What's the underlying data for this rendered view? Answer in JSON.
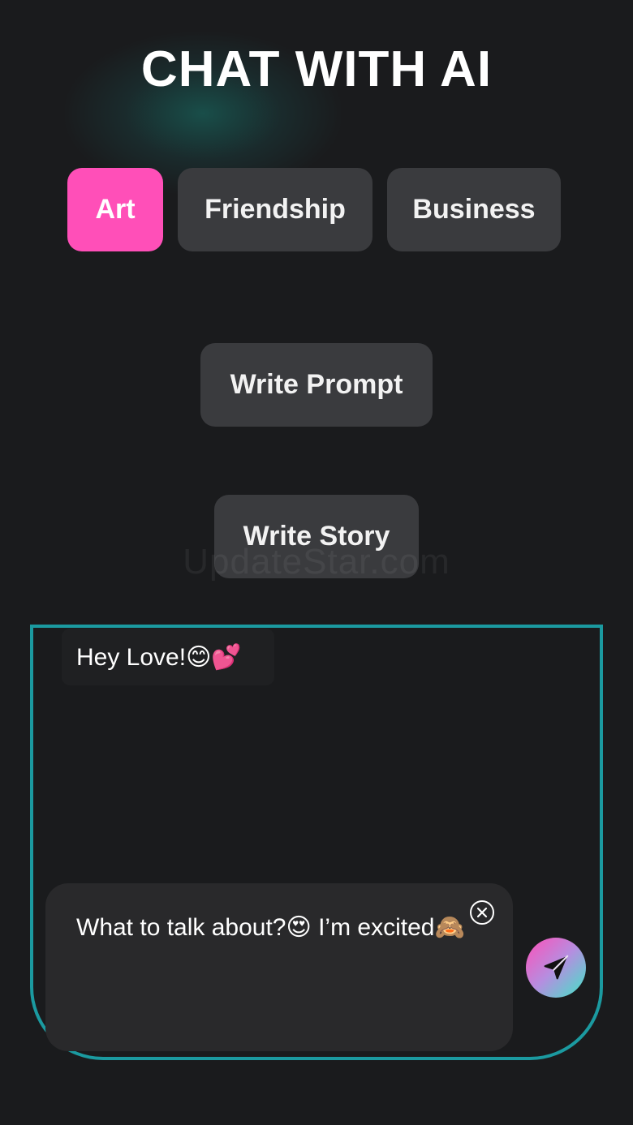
{
  "header": {
    "title": "CHAT WITH AI"
  },
  "categories": [
    {
      "label": "Art",
      "active": true
    },
    {
      "label": "Friendship",
      "active": false
    },
    {
      "label": "Business",
      "active": false
    }
  ],
  "actions": {
    "write_prompt": "Write Prompt",
    "write_story": "Write Story"
  },
  "watermark": "UpdateStar.com",
  "chat": {
    "ai_message": "Hey Love!😊💕",
    "input_value": "What to talk  about?😍 I’m excited🙈"
  },
  "icons": {
    "clear": "close-circle-icon",
    "send": "paper-plane-icon"
  },
  "colors": {
    "accent_pink": "#ff4fb8",
    "accent_teal": "#1b9aa0",
    "background": "#1a1b1d",
    "chip": "#3a3b3e"
  }
}
